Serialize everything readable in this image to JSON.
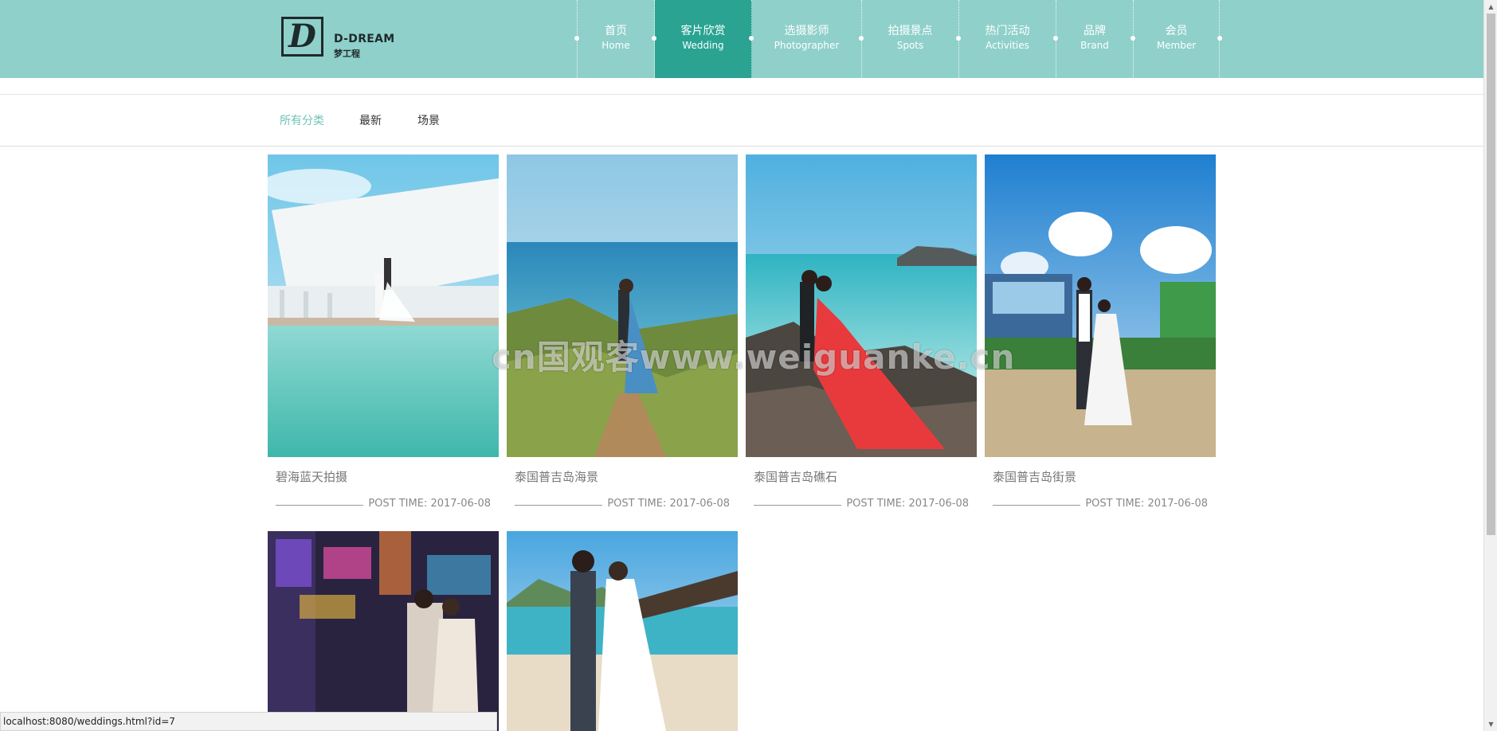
{
  "brand": {
    "logo_letter": "D",
    "name_en": "D-DREAM",
    "name_cn": "梦工程"
  },
  "nav": {
    "items": [
      {
        "cn": "首页",
        "en": "Home",
        "active": false
      },
      {
        "cn": "客片欣赏",
        "en": "Wedding",
        "active": true
      },
      {
        "cn": "选摄影师",
        "en": "Photographer",
        "active": false
      },
      {
        "cn": "拍摄景点",
        "en": "Spots",
        "active": false
      },
      {
        "cn": "热门活动",
        "en": "Activities",
        "active": false
      },
      {
        "cn": "品牌",
        "en": "Brand",
        "active": false
      },
      {
        "cn": "会员",
        "en": "Member",
        "active": false
      }
    ]
  },
  "filters": {
    "items": [
      {
        "label": "所有分类",
        "active": true
      },
      {
        "label": "最新",
        "active": false
      },
      {
        "label": "场景",
        "active": false
      }
    ]
  },
  "gallery": {
    "items": [
      {
        "title": "碧海蓝天拍摄",
        "post_label": "POST TIME: ",
        "date": "2017-06-08"
      },
      {
        "title": "泰国普吉岛海景",
        "post_label": "POST TIME: ",
        "date": "2017-06-08"
      },
      {
        "title": "泰国普吉岛礁石",
        "post_label": "POST TIME: ",
        "date": "2017-06-08"
      },
      {
        "title": "泰国普吉岛街景",
        "post_label": "POST TIME: ",
        "date": "2017-06-08"
      },
      {
        "title": "",
        "post_label": "",
        "date": ""
      },
      {
        "title": "",
        "post_label": "",
        "date": ""
      }
    ]
  },
  "watermark": "cn国观客www.weiguanke.cn",
  "status_bar": "localhost:8080/weddings.html?id=7",
  "colors": {
    "header_bg": "#8fd0ca",
    "nav_active_bg": "#2aa392",
    "filter_active": "#6fc3b8"
  }
}
